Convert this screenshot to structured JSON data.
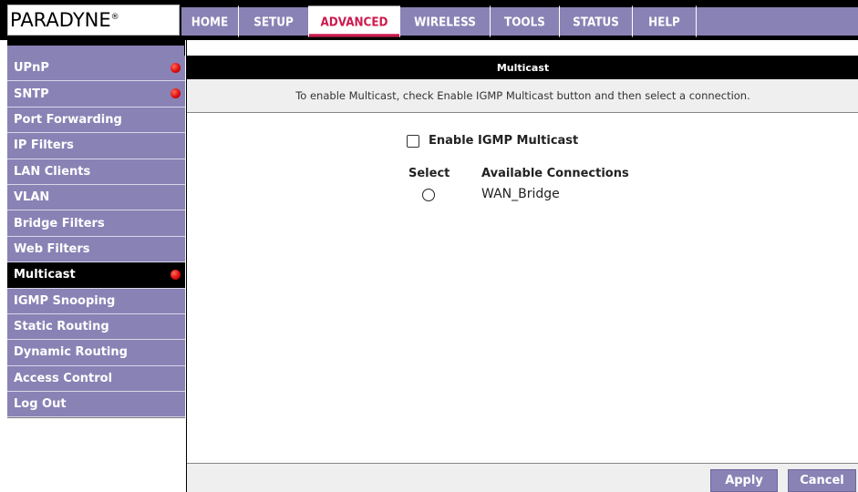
{
  "brand": {
    "logo_text": "PARADYNE",
    "logo_mark": "®"
  },
  "nav": {
    "tabs": [
      {
        "label": "HOME"
      },
      {
        "label": "SETUP"
      },
      {
        "label": "ADVANCED",
        "active": true
      },
      {
        "label": "WIRELESS"
      },
      {
        "label": "TOOLS"
      },
      {
        "label": "STATUS"
      },
      {
        "label": "HELP"
      }
    ]
  },
  "sidebar": {
    "items": [
      {
        "label": "UPnP",
        "indicator": true
      },
      {
        "label": "SNTP",
        "indicator": true
      },
      {
        "label": "Port Forwarding"
      },
      {
        "label": "IP Filters"
      },
      {
        "label": "LAN Clients"
      },
      {
        "label": "VLAN"
      },
      {
        "label": "Bridge Filters"
      },
      {
        "label": "Web Filters"
      },
      {
        "label": "Multicast",
        "active": true,
        "indicator": true
      },
      {
        "label": "IGMP Snooping"
      },
      {
        "label": "Static Routing"
      },
      {
        "label": "Dynamic Routing"
      },
      {
        "label": "Access Control"
      },
      {
        "label": "Log Out"
      }
    ]
  },
  "main": {
    "title": "Multicast",
    "description": "To enable Multicast, check Enable IGMP Multicast button and then select a connection.",
    "enable_label": "Enable IGMP Multicast",
    "enable_checked": false,
    "col_select": "Select",
    "col_connections": "Available Connections",
    "connections": [
      {
        "name": "WAN_Bridge",
        "selected": false
      }
    ]
  },
  "buttons": {
    "apply": "Apply",
    "cancel": "Cancel"
  },
  "colors": {
    "accent": "#8982b5",
    "active_tab_text": "#cc1a4d",
    "indicator": "#e00d0d",
    "title_bar": "#000000"
  }
}
